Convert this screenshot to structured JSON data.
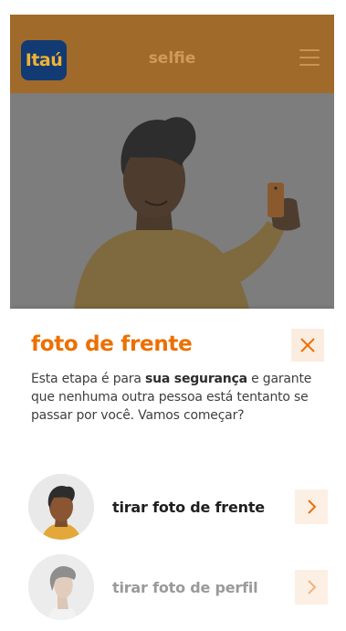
{
  "header": {
    "logo_text": "Itaú",
    "title": "selfie",
    "background": "#a06a2a"
  },
  "sheet": {
    "title": "foto de frente",
    "description_before": "Esta etapa é para ",
    "description_bold": "sua segurança",
    "description_after": " e garante que nenhuma outra pessoa está tentanto se passar por você. Vamos começar?",
    "accent_color": "#ec7000"
  },
  "options": [
    {
      "label": "tirar foto de frente",
      "icon": "chevron-right-icon",
      "state": "active"
    },
    {
      "label": "tirar foto de perfil",
      "icon": "chevron-right-icon",
      "state": "disabled"
    }
  ],
  "icons": {
    "menu": "hamburger-icon",
    "close": "close-icon"
  }
}
